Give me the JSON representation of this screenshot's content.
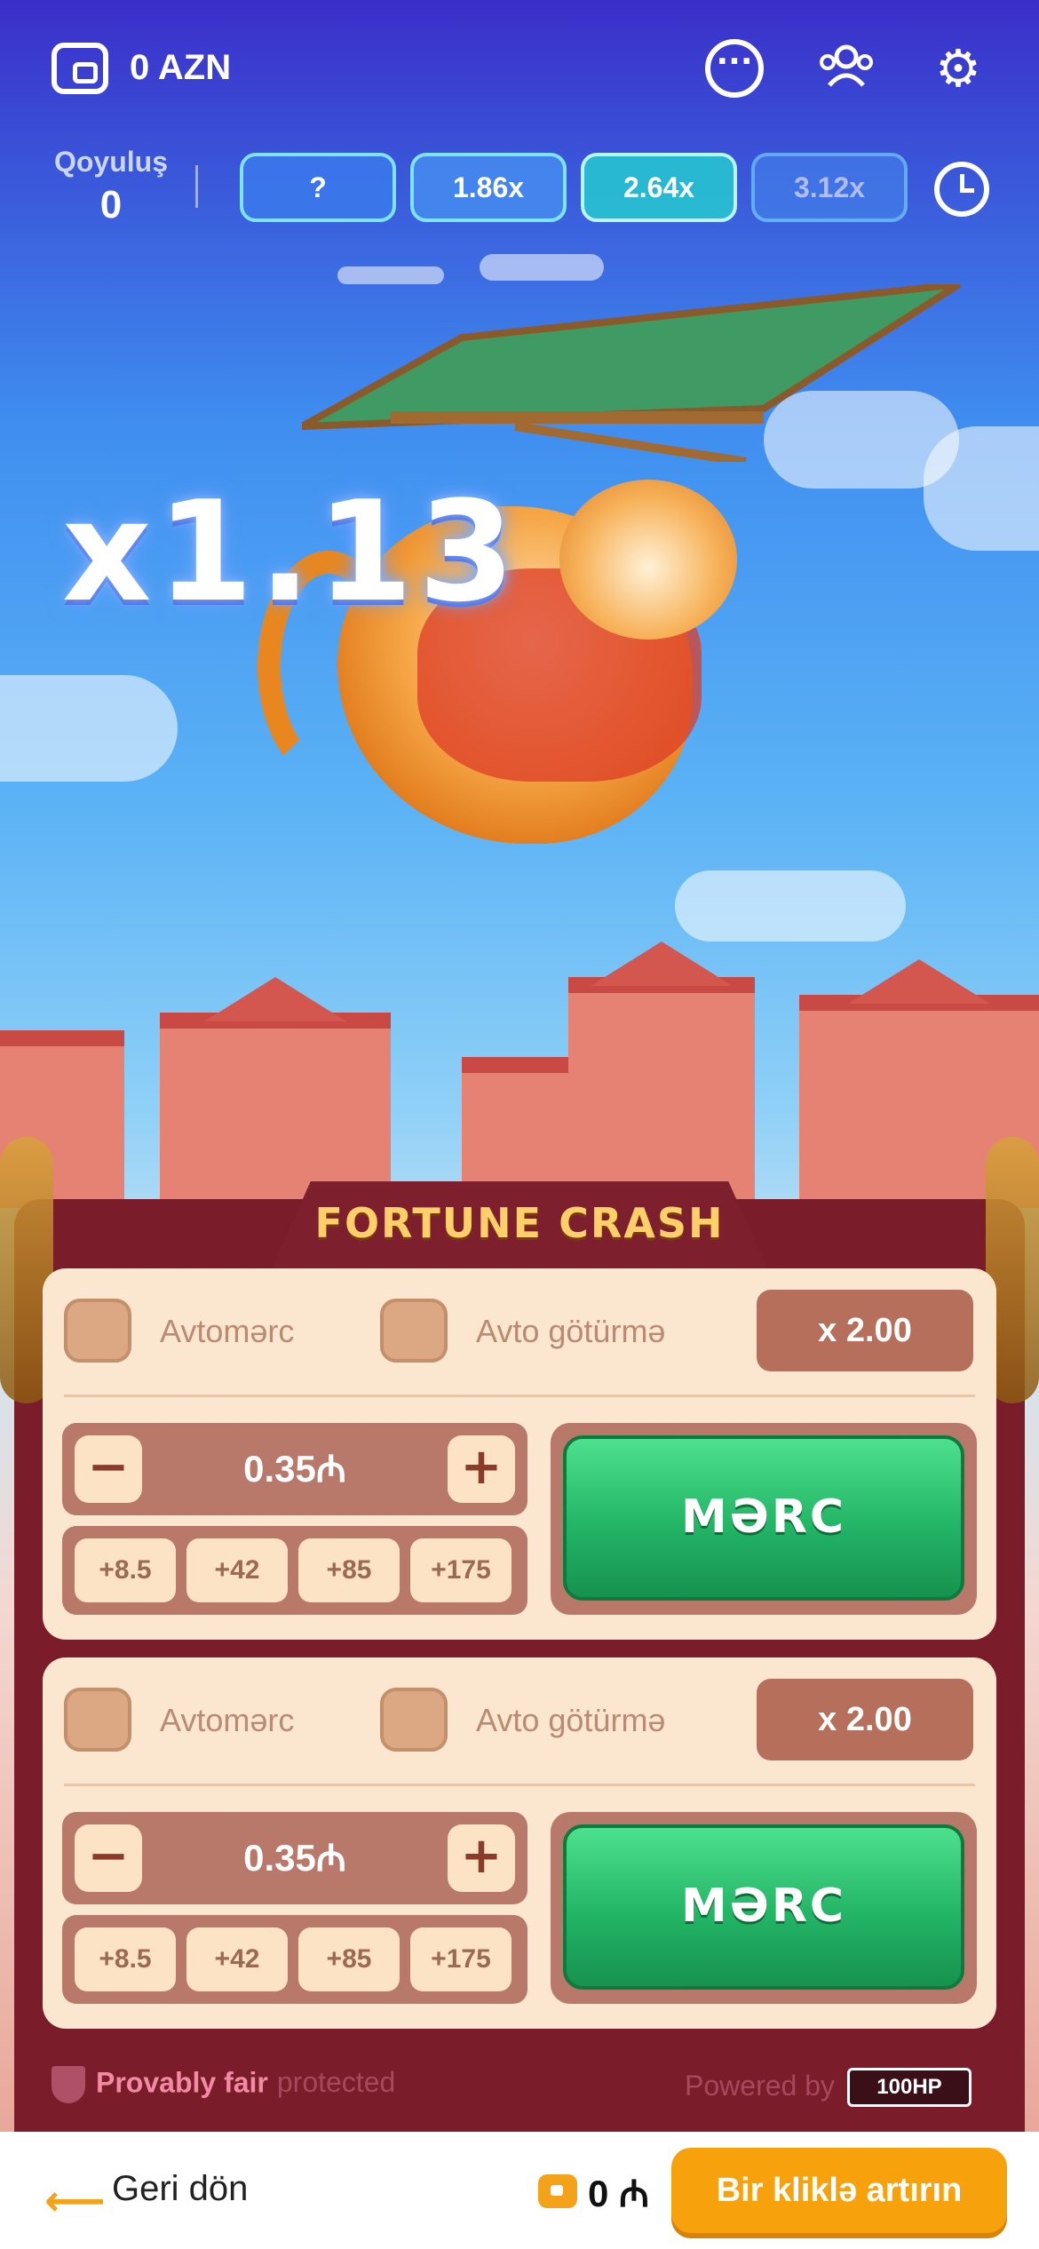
{
  "header": {
    "balance": "0 AZN",
    "icons": [
      "wallet-icon",
      "chat-icon",
      "users-icon",
      "gear-icon"
    ]
  },
  "history": {
    "stake_label": "Qoyuluş",
    "stake_value": "0",
    "chips": [
      "?",
      "1.86x",
      "2.64x",
      "3.12x"
    ]
  },
  "game": {
    "multiplier": "x1.13",
    "title": "FORTUNE CRASH"
  },
  "bets": [
    {
      "auto_bet_label": "Avtomərc",
      "auto_cashout_label": "Avto götürmə",
      "cashout_multiplier": "x 2.00",
      "amount": "0.35₼",
      "quick": [
        "+8.5",
        "+42",
        "+85",
        "+175"
      ],
      "bet_label": "MƏRC"
    },
    {
      "auto_bet_label": "Avtomərc",
      "auto_cashout_label": "Avto götürmə",
      "cashout_multiplier": "x 2.00",
      "amount": "0.35₼",
      "quick": [
        "+8.5",
        "+42",
        "+85",
        "+175"
      ],
      "bet_label": "MƏRC"
    }
  ],
  "footer": {
    "provably_fair": "Provably fair",
    "protected": "protected",
    "powered_by": "Powered by",
    "provider_logo": "100HP"
  },
  "bottombar": {
    "back_label": "Geri dön",
    "coins": "0 ₼",
    "cta_label": "Bir kliklə artırın"
  },
  "colors": {
    "accent_orange": "#f7a20c",
    "bet_green": "#23b566",
    "panel_red": "#7a1c2a"
  }
}
